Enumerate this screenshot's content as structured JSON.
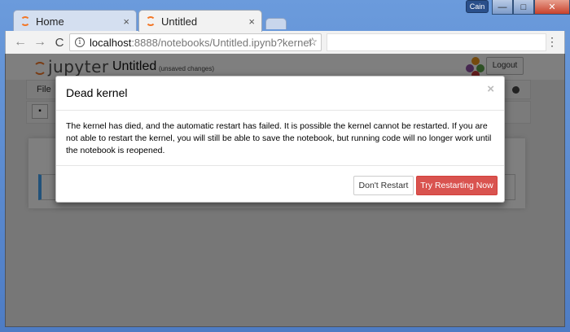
{
  "browser": {
    "tabs": [
      {
        "label": "Home",
        "close": "×"
      },
      {
        "label": "Untitled",
        "close": "×"
      }
    ],
    "window_user": "Cain",
    "controls": {
      "minimize": "—",
      "maximize": "□",
      "close": "✕"
    },
    "nav": {
      "back": "←",
      "forward": "→",
      "reload": "C"
    },
    "url_host": "localhost",
    "url_path": ":8888/notebooks/Untitled.ipynb?kernel_",
    "menu_glyph": "⋮"
  },
  "jupyter": {
    "logo_text": "jupyter",
    "notebook_title": "Untitled",
    "status": "(unsaved changes)",
    "logout_label": "Logout",
    "menu_first": "File",
    "save_glyph": "▪",
    "colors": {
      "orange": "#f37726",
      "dot_orange": "#e8951d",
      "dot_purple": "#8c4fa0",
      "dot_green": "#5aa048",
      "dot_red": "#c63b3b"
    }
  },
  "dialog": {
    "title": "Dead kernel",
    "close_glyph": "×",
    "body": "The kernel has died, and the automatic restart has failed. It is possible the kernel cannot be restarted. If you are not able to restart the kernel, you will still be able to save the notebook, but running code will no longer work until the notebook is reopened.",
    "dont_restart_label": "Don't Restart",
    "try_restart_label": "Try Restarting Now",
    "danger_color": "#d9534f"
  }
}
